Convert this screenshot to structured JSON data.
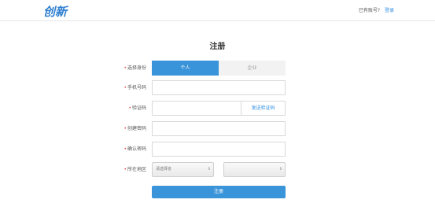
{
  "header": {
    "logo": "创新",
    "account_prompt": "已有账号?",
    "login_link": "登录"
  },
  "page": {
    "title": "注册"
  },
  "form": {
    "identity": {
      "label": "选择身份",
      "options": [
        "个人",
        "企业"
      ],
      "selected": "个人"
    },
    "phone": {
      "label": "手机号码",
      "value": "",
      "placeholder": ""
    },
    "code": {
      "label": "验证码",
      "value": "",
      "placeholder": "",
      "send_button": "发送验证码"
    },
    "password": {
      "label": "创建密码",
      "value": "",
      "placeholder": ""
    },
    "confirm": {
      "label": "确认密码",
      "value": "",
      "placeholder": ""
    },
    "region": {
      "label": "所在地区",
      "province_selected": "请选择省",
      "city_selected": ""
    },
    "submit_label": "注册",
    "required_mark": "•"
  },
  "colors": {
    "accent": "#3a94d9",
    "link": "#2f8ee0",
    "required": "#e64545"
  }
}
